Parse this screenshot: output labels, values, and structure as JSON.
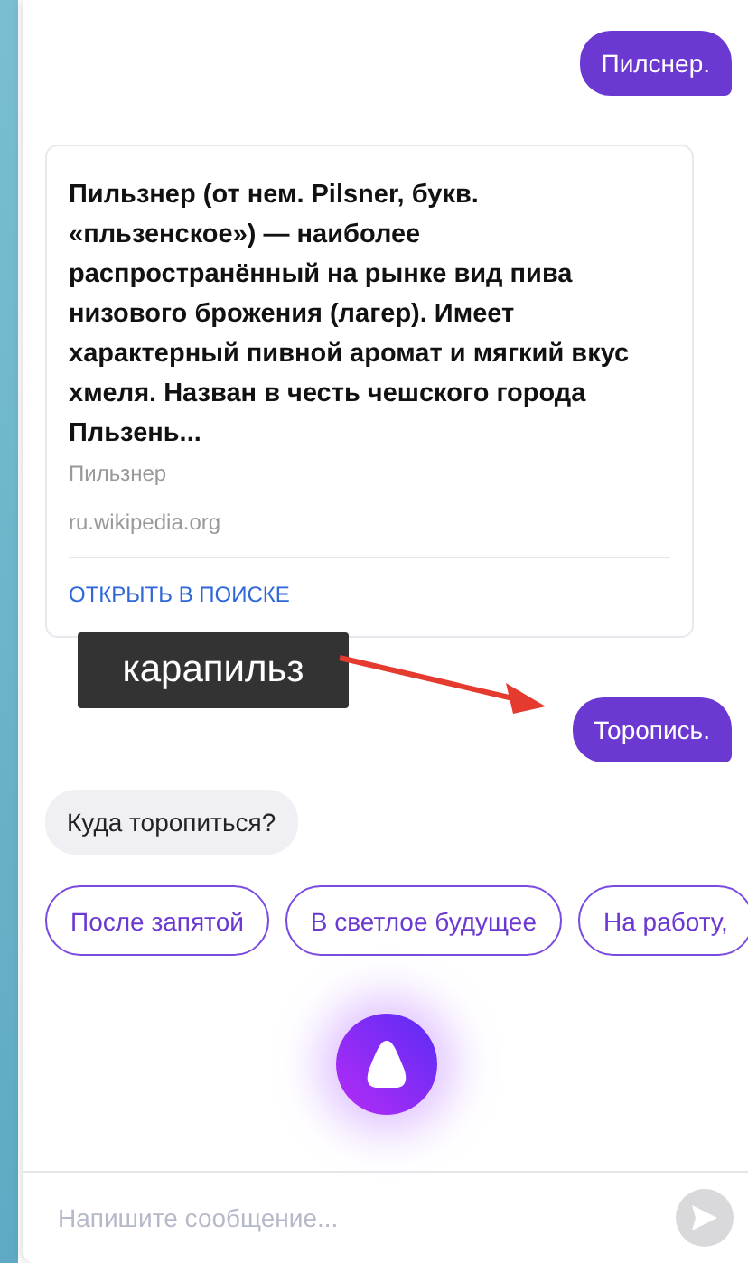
{
  "messages": [
    {
      "kind": "user",
      "text": "Пилснер."
    },
    {
      "kind": "card",
      "text": "Пильзнер (от нем. Pilsner, букв. «пльзенское») — наиболее распространённый на рынке вид пива низового брожения (лагер). Имеет характерный пивной аромат и мягкий вкус хмеля. Назван в честь чешского города Пльзень...",
      "title": "Пильзнер",
      "source": "ru.wikipedia.org",
      "link": "ОТКРЫТЬ В ПОИСКЕ"
    },
    {
      "kind": "user",
      "text": "Торопись."
    },
    {
      "kind": "bot",
      "text": "Куда торопиться?"
    }
  ],
  "suggestions": [
    "После запятой",
    "В светлое будущее",
    "На работу,"
  ],
  "annotation": {
    "label": "карапильз"
  },
  "input": {
    "placeholder": "Напишите сообщение..."
  }
}
